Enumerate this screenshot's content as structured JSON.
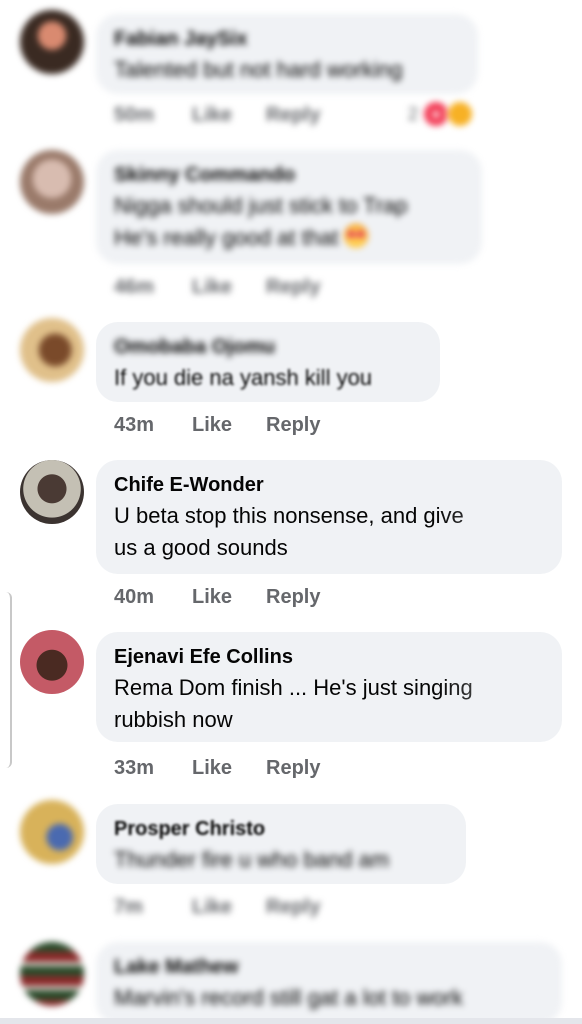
{
  "comments": [
    {
      "name": "Fabian JaySix",
      "lines": [
        "Talented but not hard working"
      ],
      "time": "50m",
      "like": "Like",
      "reply": "Reply",
      "reaction_count": "2",
      "avatar_colors": [
        "#c06a52",
        "#3a2a22"
      ]
    },
    {
      "name": "Skinny Commando",
      "lines": [
        "Nigga should just stick to Trap",
        "He's really good at that"
      ],
      "time": "46m",
      "like": "Like",
      "reply": "Reply",
      "avatar_colors": [
        "#c8a89a",
        "#8a6a5a"
      ]
    },
    {
      "name": "Omobaba Ojomu",
      "lines": [
        "If you die na yansh kill you"
      ],
      "time": "43m",
      "like": "Like",
      "reply": "Reply",
      "avatar_colors": [
        "#d9b07a",
        "#7a4a2a"
      ]
    },
    {
      "name": "Chife E-Wonder",
      "lines": [
        "U beta stop this nonsense, and give",
        "us a good sounds"
      ],
      "time": "40m",
      "like": "Like",
      "reply": "Reply",
      "avatar_colors": [
        "#b8b4a8",
        "#3b3330"
      ]
    },
    {
      "name": "Ejenavi Efe Collins",
      "lines": [
        "Rema Dom finish ... He's just singing",
        "rubbish now"
      ],
      "time": "33m",
      "like": "Like",
      "reply": "Reply",
      "avatar_colors": [
        "#b34a57",
        "#5a2c2c"
      ]
    },
    {
      "name": "Prosper Christo",
      "lines": [
        "Thunder fire u who band am"
      ],
      "time": "7m",
      "like": "Like",
      "reply": "Reply",
      "avatar_colors": [
        "#d8b25a",
        "#4a6ab0"
      ]
    },
    {
      "name": "Lake Mathew",
      "lines": [
        "Marvin's record still gat a lot to work"
      ],
      "avatar_colors": [
        "#2a4a2a",
        "#8a2a2a"
      ]
    }
  ]
}
